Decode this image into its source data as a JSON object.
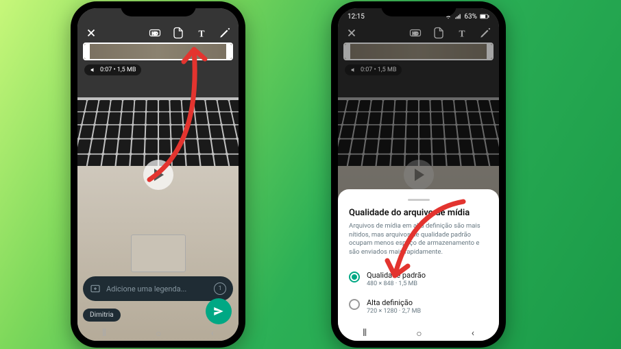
{
  "status": {
    "time": "12:15",
    "battery": "63%"
  },
  "editor": {
    "meta": "0:07 • 1,5 MB"
  },
  "caption": {
    "placeholder": "Adicione uma legenda...",
    "once_label": "1"
  },
  "recipient": {
    "name": "Dimitria"
  },
  "sheet": {
    "title": "Qualidade do arquivo de mídia",
    "desc": "Arquivos de mídia em alta definição são mais nítidos, mas arquivos de qualidade padrão ocupam menos espaço de armazenamento e são enviados mais rapidamente.",
    "opt1": {
      "title": "Qualidade padrão",
      "sub": "480 × 848 · 1,5 MB"
    },
    "opt2": {
      "title": "Alta definição",
      "sub": "720 × 1280 · 2,7 MB"
    }
  }
}
